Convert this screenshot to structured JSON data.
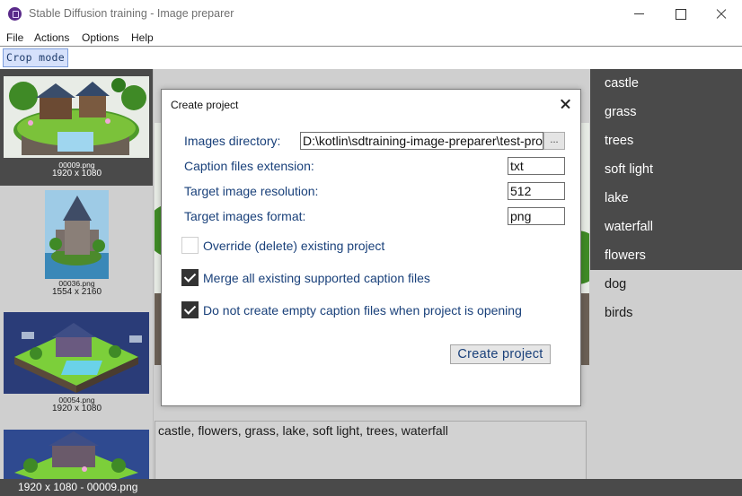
{
  "window": {
    "title": "Stable Diffusion training - Image preparer",
    "controls": [
      "minimize",
      "maximize",
      "close"
    ]
  },
  "menu": {
    "items": [
      "File",
      "Actions",
      "Options",
      "Help"
    ]
  },
  "toolbar": {
    "crop_mode_label": "Crop mode"
  },
  "thumbnails": [
    {
      "filename": "00009.png",
      "size": "1920 x 1080",
      "selected": true
    },
    {
      "filename": "00036.png",
      "size": "1554 x 2160",
      "selected": false
    },
    {
      "filename": "00054.png",
      "size": "1920 x 1080",
      "selected": false
    },
    {
      "filename": "",
      "size": "",
      "selected": false
    }
  ],
  "caption": {
    "text": "castle, flowers, grass, lake, soft light, trees, waterfall"
  },
  "tags": [
    {
      "label": "castle",
      "active": true
    },
    {
      "label": "grass",
      "active": true
    },
    {
      "label": "trees",
      "active": true
    },
    {
      "label": "soft light",
      "active": true
    },
    {
      "label": "lake",
      "active": true
    },
    {
      "label": "waterfall",
      "active": true
    },
    {
      "label": "flowers",
      "active": true
    },
    {
      "label": "dog",
      "active": false
    },
    {
      "label": "birds",
      "active": false
    }
  ],
  "status": {
    "text": "1920 x 1080 - 00009.png"
  },
  "dialog": {
    "title": "Create project",
    "images_directory_label": "Images directory:",
    "images_directory_value": "D:\\kotlin\\sdtraining-image-preparer\\test-pro",
    "browse_label": "...",
    "caption_ext_label": "Caption files extension:",
    "caption_ext_value": "txt",
    "target_res_label": "Target image resolution:",
    "target_res_value": "512",
    "target_format_label": "Target images format:",
    "target_format_value": "png",
    "override_label": "Override (delete) existing project",
    "override_checked": false,
    "merge_label": "Merge all existing supported caption files",
    "merge_checked": true,
    "no_empty_label": "Do not create empty caption files when project is opening",
    "no_empty_checked": true,
    "create_button_label": "Create project"
  },
  "colors": {
    "accent_text": "#19407a",
    "selected_bg": "#4a4a4a",
    "panel_bg": "#cfcfcf",
    "crop_button_bg": "#d6e1fb"
  }
}
